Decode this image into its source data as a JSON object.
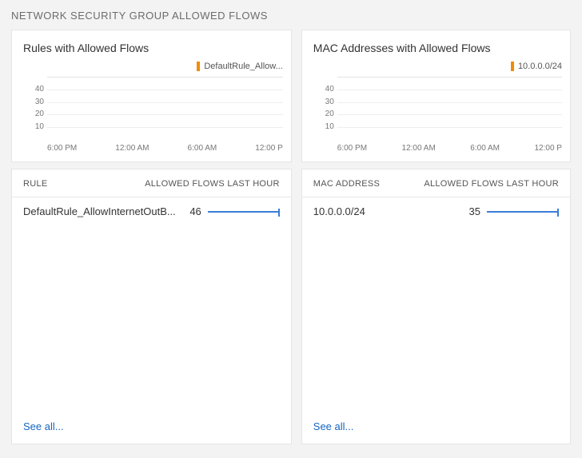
{
  "page_title": "NETWORK SECURITY GROUP ALLOWED FLOWS",
  "panels": [
    {
      "chart_title": "Rules with Allowed Flows",
      "legend_label": "DefaultRule_Allow...",
      "table": {
        "col1": "RULE",
        "col2": "ALLOWED FLOWS LAST HOUR",
        "rows": [
          {
            "label": "DefaultRule_AllowInternetOutB...",
            "value": 46,
            "pct": 100
          }
        ]
      },
      "see_all": "See all..."
    },
    {
      "chart_title": "MAC Addresses with Allowed Flows",
      "legend_label": "10.0.0.0/24",
      "table": {
        "col1": "MAC ADDRESS",
        "col2": "ALLOWED FLOWS LAST HOUR",
        "rows": [
          {
            "label": "10.0.0.0/24",
            "value": 35,
            "pct": 100
          }
        ]
      },
      "see_all": "See all..."
    }
  ],
  "chart_data": [
    {
      "type": "line",
      "title": "Rules with Allowed Flows",
      "series": [
        {
          "name": "DefaultRule_Allow...",
          "values": []
        }
      ],
      "x_ticks": [
        "6:00 PM",
        "12:00 AM",
        "6:00 AM",
        "12:00 P"
      ],
      "y_ticks": [
        10,
        20,
        30,
        40
      ],
      "ylim": [
        0,
        50
      ],
      "legend_color": "#f08c00"
    },
    {
      "type": "line",
      "title": "MAC Addresses with Allowed Flows",
      "series": [
        {
          "name": "10.0.0.0/24",
          "values": []
        }
      ],
      "x_ticks": [
        "6:00 PM",
        "12:00 AM",
        "6:00 AM",
        "12:00 P"
      ],
      "y_ticks": [
        10,
        20,
        30,
        40
      ],
      "ylim": [
        0,
        50
      ],
      "legend_color": "#f08c00"
    }
  ]
}
